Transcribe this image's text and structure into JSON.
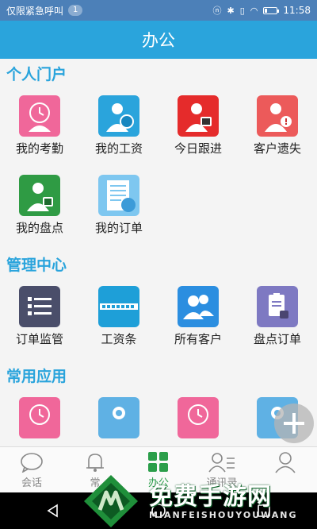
{
  "status_bar": {
    "carrier": "仅限紧急呼叫",
    "notification_count": "1",
    "time": "11:58",
    "battery_level": 0.2
  },
  "header": {
    "title": "办公"
  },
  "sections": [
    {
      "title": "个人门户",
      "items": [
        {
          "label": "我的考勤",
          "icon": "attendance-icon",
          "color": "#f0679a"
        },
        {
          "label": "我的工资",
          "icon": "salary-icon",
          "color": "#2aa4dc"
        },
        {
          "label": "今日跟进",
          "icon": "follow-up-icon",
          "color": "#e52b2b"
        },
        {
          "label": "客户遗失",
          "icon": "customer-lost-icon",
          "color": "#ec5a5a"
        },
        {
          "label": "我的盘点",
          "icon": "inventory-icon",
          "color": "#2f9b44"
        },
        {
          "label": "我的订单",
          "icon": "my-order-icon",
          "color": "#7ec7f0"
        }
      ]
    },
    {
      "title": "管理中心",
      "items": [
        {
          "label": "订单监管",
          "icon": "order-monitor-icon",
          "color": "#4a4e6a"
        },
        {
          "label": "工资条",
          "icon": "payslip-icon",
          "color": "#1e9fd8"
        },
        {
          "label": "所有客户",
          "icon": "all-customers-icon",
          "color": "#2b8ee0"
        },
        {
          "label": "盘点订单",
          "icon": "inventory-order-icon",
          "color": "#7e79c2"
        }
      ]
    },
    {
      "title": "常用应用",
      "items": [
        {
          "label": "",
          "icon": "attendance-icon",
          "color": "#f0679a"
        },
        {
          "label": "",
          "icon": "clock-icon",
          "color": "#5fb1e4"
        },
        {
          "label": "",
          "icon": "attendance-icon",
          "color": "#f0679a"
        },
        {
          "label": "",
          "icon": "clock-icon",
          "color": "#5fb1e4"
        }
      ]
    }
  ],
  "tabs": [
    {
      "label": "会话",
      "icon": "chat-icon",
      "active": false
    },
    {
      "label": "常",
      "icon": "bell-icon",
      "active": false
    },
    {
      "label": "办公",
      "icon": "apps-grid-icon",
      "active": true
    },
    {
      "label": "通讯录",
      "icon": "contacts-icon",
      "active": false
    },
    {
      "label": "",
      "icon": "profile-icon",
      "active": false
    }
  ],
  "watermark": {
    "title": "免费手游网",
    "subtitle": "MIANFEISHOUYOUWANG"
  }
}
